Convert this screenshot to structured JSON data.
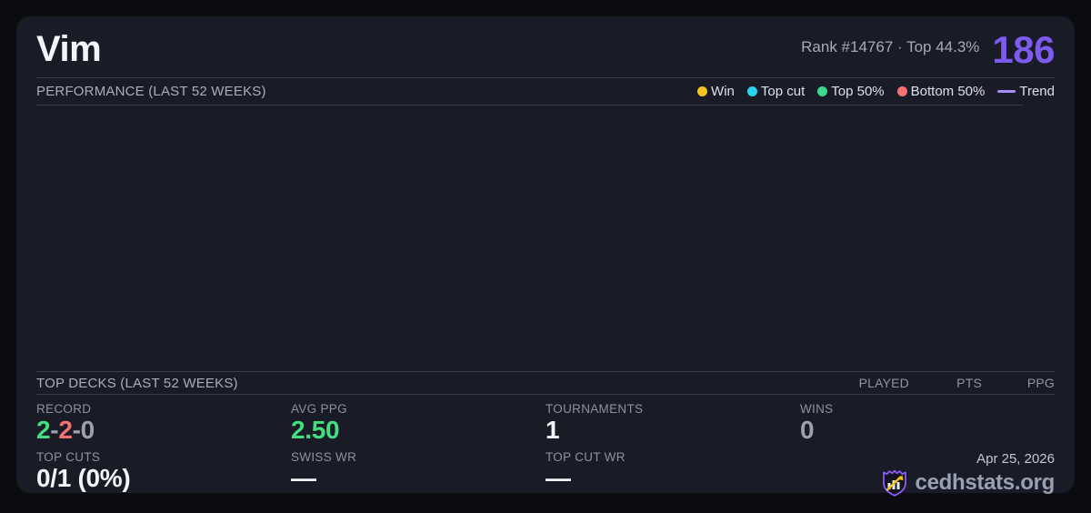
{
  "header": {
    "title": "Vim",
    "rank_text": "Rank #14767  ·  Top 44.3%",
    "score": "186"
  },
  "performance": {
    "title": "PERFORMANCE (LAST 52 WEEKS)",
    "legend": [
      {
        "label": "Win",
        "marker": "dot",
        "color": "#f2c41d"
      },
      {
        "label": "Top cut",
        "marker": "dot",
        "color": "#29d3ee"
      },
      {
        "label": "Top 50%",
        "marker": "dot",
        "color": "#3bd98b"
      },
      {
        "label": "Bottom 50%",
        "marker": "dot",
        "color": "#f87171"
      },
      {
        "label": "Trend",
        "marker": "line",
        "color": "#a78bfa"
      }
    ]
  },
  "chart_data": {
    "type": "scatter",
    "title": "PERFORMANCE (LAST 52 WEEKS)",
    "series": [],
    "note_visible_points": "no data points plotted - chart plot area is empty",
    "legend_entries": [
      "Win",
      "Top cut",
      "Top 50%",
      "Bottom 50%",
      "Trend"
    ],
    "grid": false
  },
  "top_decks": {
    "title": "TOP DECKS (LAST 52 WEEKS)",
    "columns": [
      "PLAYED",
      "PTS",
      "PPG"
    ]
  },
  "stats": {
    "record": {
      "label": "RECORD",
      "wins": "2",
      "losses": "2",
      "draws": "0",
      "sep": "-"
    },
    "avg_ppg": {
      "label": "AVG PPG",
      "value": "2.50"
    },
    "tournaments": {
      "label": "TOURNAMENTS",
      "value": "1"
    },
    "wins": {
      "label": "WINS",
      "value": "0"
    },
    "top_cuts": {
      "label": "TOP CUTS",
      "value": "0/1 (0%)"
    },
    "swiss_wr": {
      "label": "SWISS WR",
      "value": "—"
    },
    "top_cut_wr": {
      "label": "TOP CUT WR",
      "value": "—"
    }
  },
  "footer": {
    "date": "Apr 25, 2026",
    "brand": "cedhstats.org"
  },
  "colors": {
    "accent_purple": "#7d5bef",
    "win_green": "#42de80",
    "loss_red": "#f87171",
    "neutral_gray": "#9aa0ae",
    "card_bg": "#191c26",
    "page_bg": "#0b0c10"
  }
}
